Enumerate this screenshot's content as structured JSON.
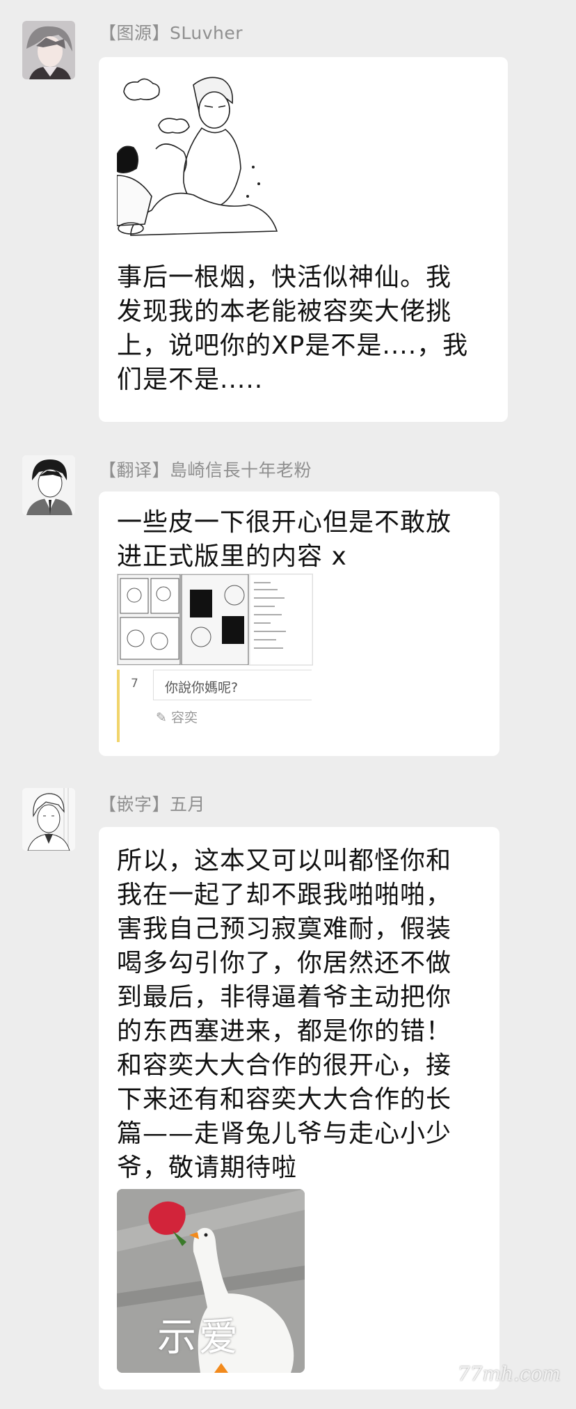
{
  "messages": [
    {
      "sender": "【图源】SLuvher",
      "text_lines": [
        "事后一根烟，快活似神仙。我",
        "发现我的本老能被容奕大佬挑",
        "上，说吧你的XP是不是....，我",
        "们是不是....."
      ]
    },
    {
      "sender": "【翻译】島崎信長十年老粉",
      "text_lines": [
        "一些皮一下很开心但是不敢放",
        "进正式版里的内容 x"
      ],
      "comment": {
        "number": "7",
        "text": "你說你媽呢?",
        "author": "✎ 容奕"
      }
    },
    {
      "sender": "【嵌字】五月",
      "text_lines": [
        "所以，这本又可以叫都怪你和",
        "我在一起了却不跟我啪啪啪，",
        "害我自己预习寂寞难耐，假装",
        "喝多勾引你了，你居然还不做",
        "到最后，非得逼着爷主动把你",
        "的东西塞进来，都是你的错！",
        "和容奕大大合作的很开心，接",
        "下来还有和容奕大大合作的长",
        "篇——走肾兔儿爷与走心小少",
        "爷，敬请期待啦"
      ],
      "sticker_text": "示爱"
    }
  ],
  "watermark": "77mh.com"
}
